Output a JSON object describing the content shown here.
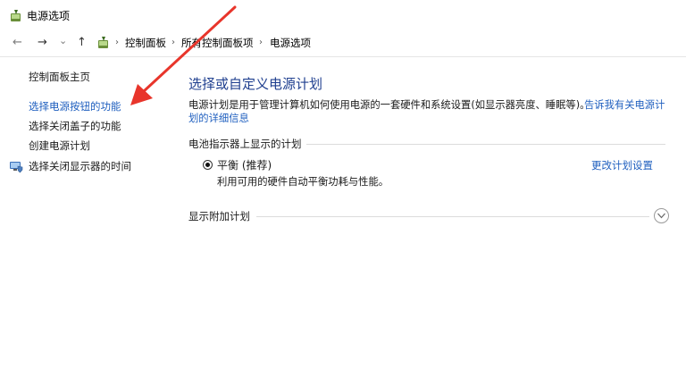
{
  "window": {
    "title": "电源选项"
  },
  "nav": {
    "back": "←",
    "forward": "→",
    "history": "⌄",
    "up": "↑"
  },
  "breadcrumb": {
    "items": [
      "控制面板",
      "所有控制面板项",
      "电源选项"
    ],
    "separator": "›"
  },
  "sidebar": {
    "items": [
      {
        "label": "控制面板主页"
      },
      {
        "label": "选择电源按钮的功能"
      },
      {
        "label": "选择关闭盖子的功能"
      },
      {
        "label": "创建电源计划"
      },
      {
        "label": "选择关闭显示器的时间"
      }
    ]
  },
  "main": {
    "title": "选择或自定义电源计划",
    "description": "电源计划是用于管理计算机如何使用电源的一套硬件和系统设置(如显示器亮度、睡眠等)。",
    "link_line1": "告诉我有关电源计",
    "link_line2": "划的详细信息",
    "section1": "电池指示器上显示的计划",
    "plan": {
      "name": "平衡 (推荐)",
      "description": "利用可用的硬件自动平衡功耗与性能。",
      "change_link": "更改计划设置"
    },
    "section2": "显示附加计划"
  },
  "colors": {
    "link": "#1f5fbf",
    "title": "#1f3f8f",
    "arrow": "#e8352b"
  },
  "icons": [
    "power-options-icon",
    "monitor-shield-icon",
    "expand-chevron-icon"
  ]
}
